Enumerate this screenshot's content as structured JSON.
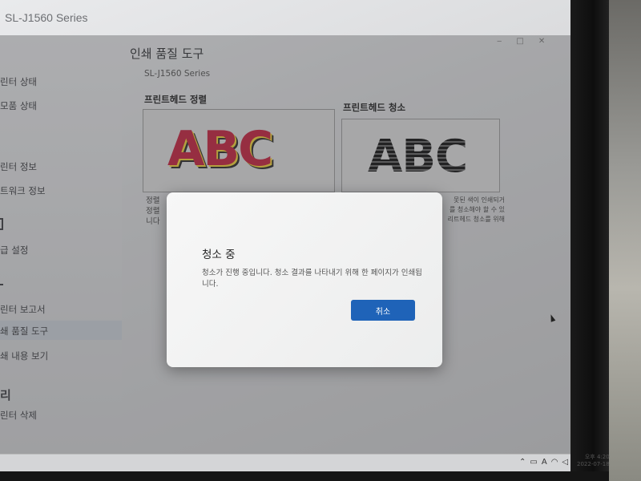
{
  "window": {
    "title": "SL-J1560 Series",
    "controls": [
      "‒",
      "□",
      "✕"
    ]
  },
  "sidebar": {
    "items": [
      {
        "label": "린터 상태"
      },
      {
        "label": "모품 상태"
      },
      {
        "label": "린터 정보"
      },
      {
        "label": "트워크 정보"
      },
      {
        "label": "급 설정"
      },
      {
        "label": "린터 보고서"
      },
      {
        "label": "쇄 품질 도구"
      },
      {
        "label": "쇄 내용 보기"
      },
      {
        "label": "린터 삭제"
      }
    ],
    "groups": [
      "정",
      "리"
    ]
  },
  "main": {
    "page_title": "인쇄 품질 도구",
    "model": "SL-J1560 Series",
    "tools": [
      {
        "heading": "프린트헤드 정렬",
        "sample": "ABC",
        "desc_lines": [
          "정렬",
          "정렬",
          "니다"
        ]
      },
      {
        "heading": "프린트헤드 청소",
        "sample": "ABC",
        "desc_lines": [
          "못된 색이 인쇄되거",
          "를 청소해야 할 수 있",
          "리트헤드 청소를 위해"
        ]
      }
    ]
  },
  "dialog": {
    "title": "청소 중",
    "message": "청소가 진행 중입니다. 청소 결과를 나타내기 위해 한 페이지가 인쇄됩니다.",
    "cancel_label": "취소"
  },
  "taskbar": {
    "tray_icons": [
      "chevron-up-icon",
      "keyboard-icon",
      "language-icon",
      "wifi-icon",
      "volume-icon",
      "battery-icon"
    ],
    "lang": "A",
    "time": "오후 4:20",
    "date": "2022-07-18"
  },
  "colors": {
    "accent": "#1f63b8",
    "sample_red": "#c2223e",
    "sample_yellow": "#f0d23a"
  }
}
